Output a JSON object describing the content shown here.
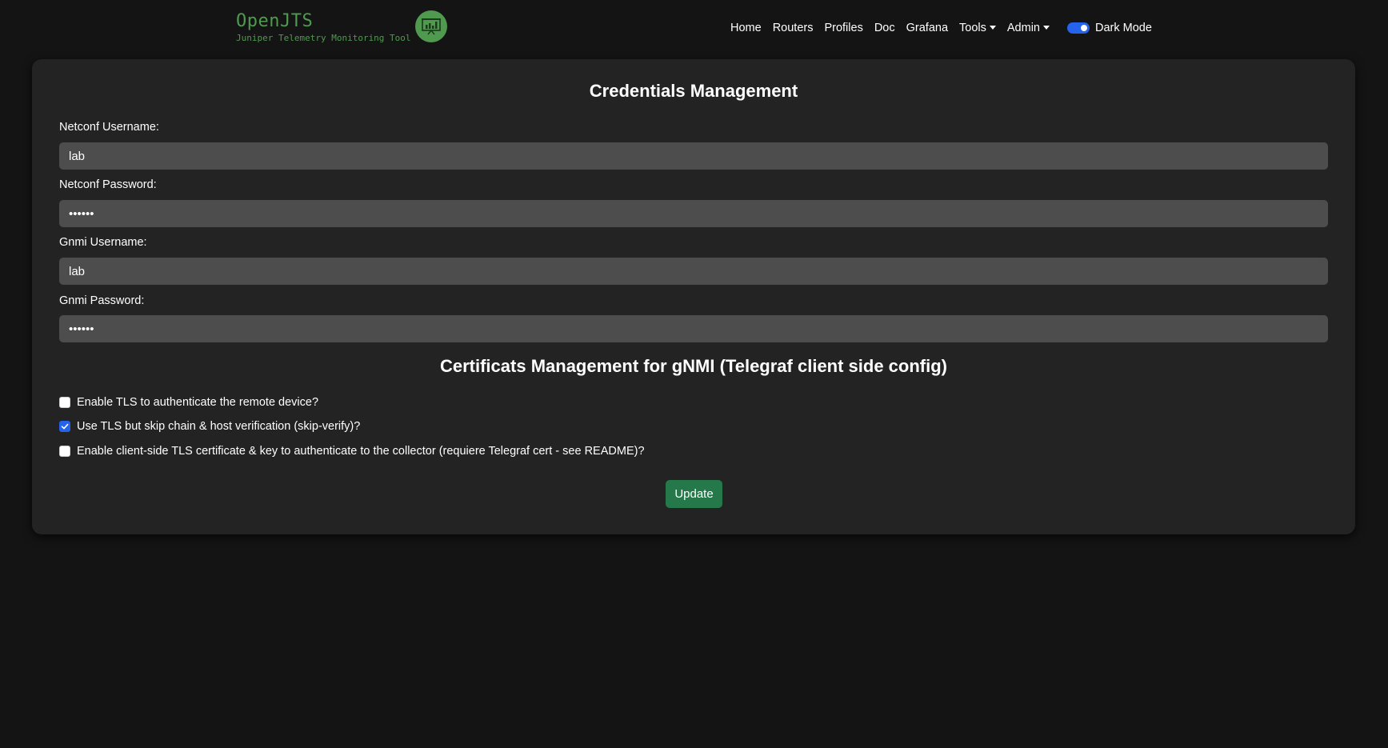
{
  "brand": {
    "title": "OpenJTS",
    "subtitle": "Juniper Telemetry Monitoring Tool",
    "logo_icon": "chart-presentation-icon",
    "color": "#4f9a4f"
  },
  "nav": {
    "home": "Home",
    "routers": "Routers",
    "profiles": "Profiles",
    "doc": "Doc",
    "grafana": "Grafana",
    "tools": "Tools",
    "admin": "Admin",
    "dark_mode_label": "Dark Mode",
    "dark_mode_on": true
  },
  "credentials": {
    "title": "Credentials Management",
    "netconf_username_label": "Netconf Username:",
    "netconf_username_value": "lab",
    "netconf_password_label": "Netconf Password:",
    "netconf_password_value": "••••••",
    "gnmi_username_label": "Gnmi Username:",
    "gnmi_username_value": "lab",
    "gnmi_password_label": "Gnmi Password:",
    "gnmi_password_value": "••••••"
  },
  "certificates": {
    "title": "Certificats Management for gNMI (Telegraf client side config)",
    "options": [
      {
        "label": "Enable TLS to authenticate the remote device?",
        "checked": false
      },
      {
        "label": "Use TLS but skip chain & host verification (skip-verify)?",
        "checked": true
      },
      {
        "label": "Enable client-side TLS certificate & key to authenticate to the collector (requiere Telegraf cert - see README)?",
        "checked": false
      }
    ]
  },
  "actions": {
    "update_label": "Update"
  },
  "colors": {
    "background": "#141414",
    "card": "#232323",
    "input": "#4d4d4d",
    "accent": "#2563eb",
    "button": "#24784a"
  }
}
